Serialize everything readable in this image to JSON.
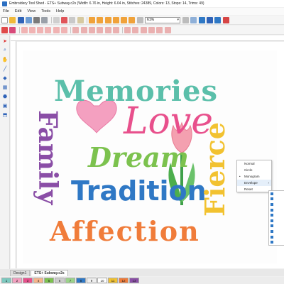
{
  "window": {
    "title": "Embroidery Tool Shed - ETS+ Subway.c2s (Width: 6.76 in, Height: 6.04 in, Stitches: 24389, Colors: 13, Stops: 14, Trims: 49)"
  },
  "menu": [
    "File",
    "Edit",
    "View",
    "Tools",
    "Help"
  ],
  "toolbar": {
    "zoom_value": "61%"
  },
  "design_text": {
    "memories": "Memories",
    "love": "Love",
    "dream": "Dream",
    "tradition": "Tradition",
    "family": "Family",
    "fierce": "Fierce",
    "affection": "Affection"
  },
  "context_menu": {
    "items": [
      "Normal",
      "Circle",
      "Monogram",
      "Envelope",
      "Reset"
    ],
    "checked": "Monogram",
    "highlighted": "Envelope"
  },
  "document_tabs": [
    "Design1",
    "ETS+ Subway.c2s"
  ],
  "active_tab": "ETS+ Subway.c2s",
  "color_bar": {
    "labels": [
      "1",
      "2",
      "3",
      "4",
      "5",
      "6",
      "7",
      "8",
      "9",
      "10",
      "11",
      "12",
      "13"
    ],
    "colors": [
      "#7ccac0",
      "#f4a0c0",
      "#e8508c",
      "#f7b48a",
      "#7cc24e",
      "#cccccc",
      "#9bd38a",
      "#2f78c5",
      "#eeeeee",
      "#ffffff",
      "#f2c230",
      "#f07c3a",
      "#8a4ea6"
    ]
  }
}
